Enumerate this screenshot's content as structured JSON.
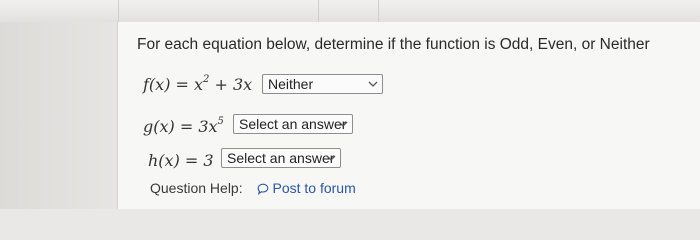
{
  "question": {
    "prompt": "For each equation below, determine if the function is Odd, Even, or Neither"
  },
  "equations": [
    {
      "lhs": "f(x)",
      "rhs_base": "= x",
      "rhs_exp": "2",
      "rhs_tail": " + 3x",
      "answer": "Neither"
    },
    {
      "lhs": "g(x)",
      "rhs_base": "= 3x",
      "rhs_exp": "5",
      "rhs_tail": "",
      "answer": "Select an answer"
    },
    {
      "lhs": "h(x)",
      "rhs_base": "= 3",
      "rhs_exp": "",
      "rhs_tail": "",
      "answer": "Select an answer"
    }
  ],
  "help": {
    "label": "Question Help:",
    "link": "Post to forum"
  },
  "icons": {
    "dropdown": "chevron-down-icon",
    "forum": "speech-bubble-icon"
  },
  "colors": {
    "link": "#2b57a8",
    "text": "#2a2a2a"
  }
}
